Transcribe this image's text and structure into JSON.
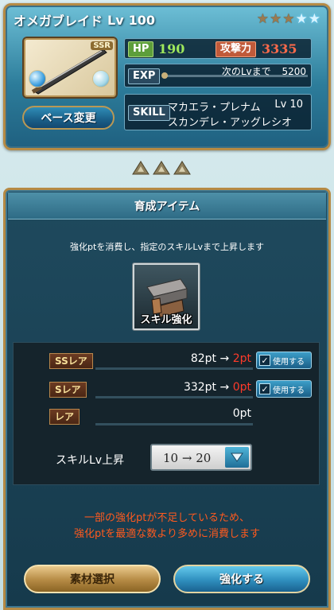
{
  "weapon": {
    "name": "オメガブレイド",
    "level_label": "Lv",
    "level": "100",
    "rarity_badge": "SSR",
    "stars": [
      "bronze",
      "bronze",
      "bronze",
      "blue",
      "blue"
    ]
  },
  "stats": {
    "hp_label": "HP",
    "hp_value": "190",
    "atk_label": "攻撃力",
    "atk_value": "3335",
    "exp_label": "EXP",
    "exp_next_text": "次のLvまで",
    "exp_next_value": "5200",
    "exp_progress": 0
  },
  "skill": {
    "label": "SKILL",
    "name1": "マカエラ・プレナム",
    "level_text": "Lv 10",
    "name2": "スカンデレ・アッグレシオ"
  },
  "buttons": {
    "base_change": "ベース変更",
    "material_select": "素材選択",
    "enhance": "強化する"
  },
  "enhance_panel": {
    "title": "育成アイテム",
    "description": "強化ptを消費し、指定のスキルLvまで上昇します",
    "item_label": "スキル強化",
    "rows": [
      {
        "rarity": "SSレア",
        "from": "82pt",
        "arrow": "→",
        "to": "2pt",
        "use_label": "使用する",
        "checked": true
      },
      {
        "rarity": "Sレア",
        "from": "332pt",
        "arrow": "→",
        "to": "0pt",
        "use_label": "使用する",
        "checked": true
      },
      {
        "rarity": "レア",
        "value": "0pt"
      }
    ],
    "skill_lv_label": "スキルLv上昇",
    "skill_lv_select": "10 → 20",
    "warning_line1": "一部の強化ptが不足しているため、",
    "warning_line2": "強化ptを最適な数より多めに消費します"
  }
}
